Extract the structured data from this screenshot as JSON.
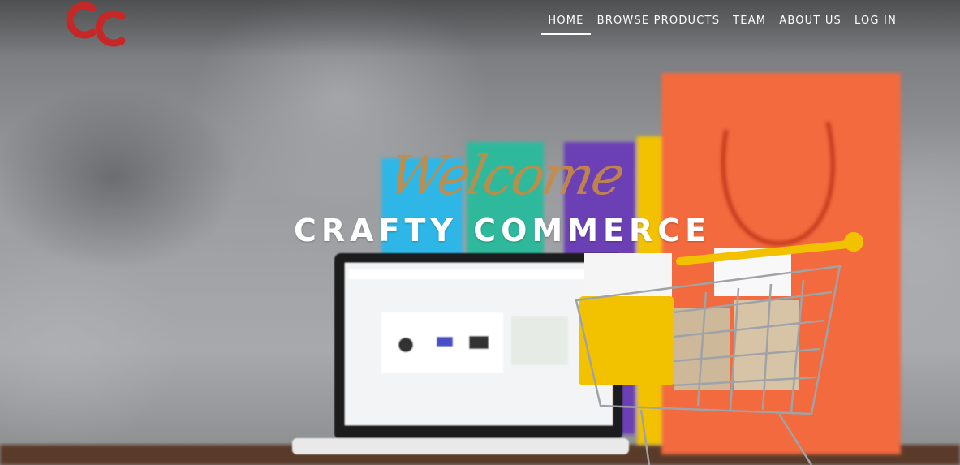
{
  "brand": {
    "logo_icon": "crafty-commerce-logo-icon"
  },
  "nav": {
    "items": [
      {
        "label": "HOME",
        "active": true
      },
      {
        "label": "BROWSE PRODUCTS",
        "active": false
      },
      {
        "label": "TEAM",
        "active": false
      },
      {
        "label": "ABOUT US",
        "active": false
      },
      {
        "label": "LOG IN",
        "active": false
      }
    ]
  },
  "hero": {
    "script_text": "Welcome",
    "title": "CRAFTY COMMERCE",
    "background_icon": "shopping-cart-laptop-bags-photo"
  },
  "colors": {
    "logo": "#c62828",
    "script": "#c98a43",
    "nav_text": "#ffffff",
    "bag_orange": "#f26a3d",
    "cart_yellow": "#f2c200"
  }
}
